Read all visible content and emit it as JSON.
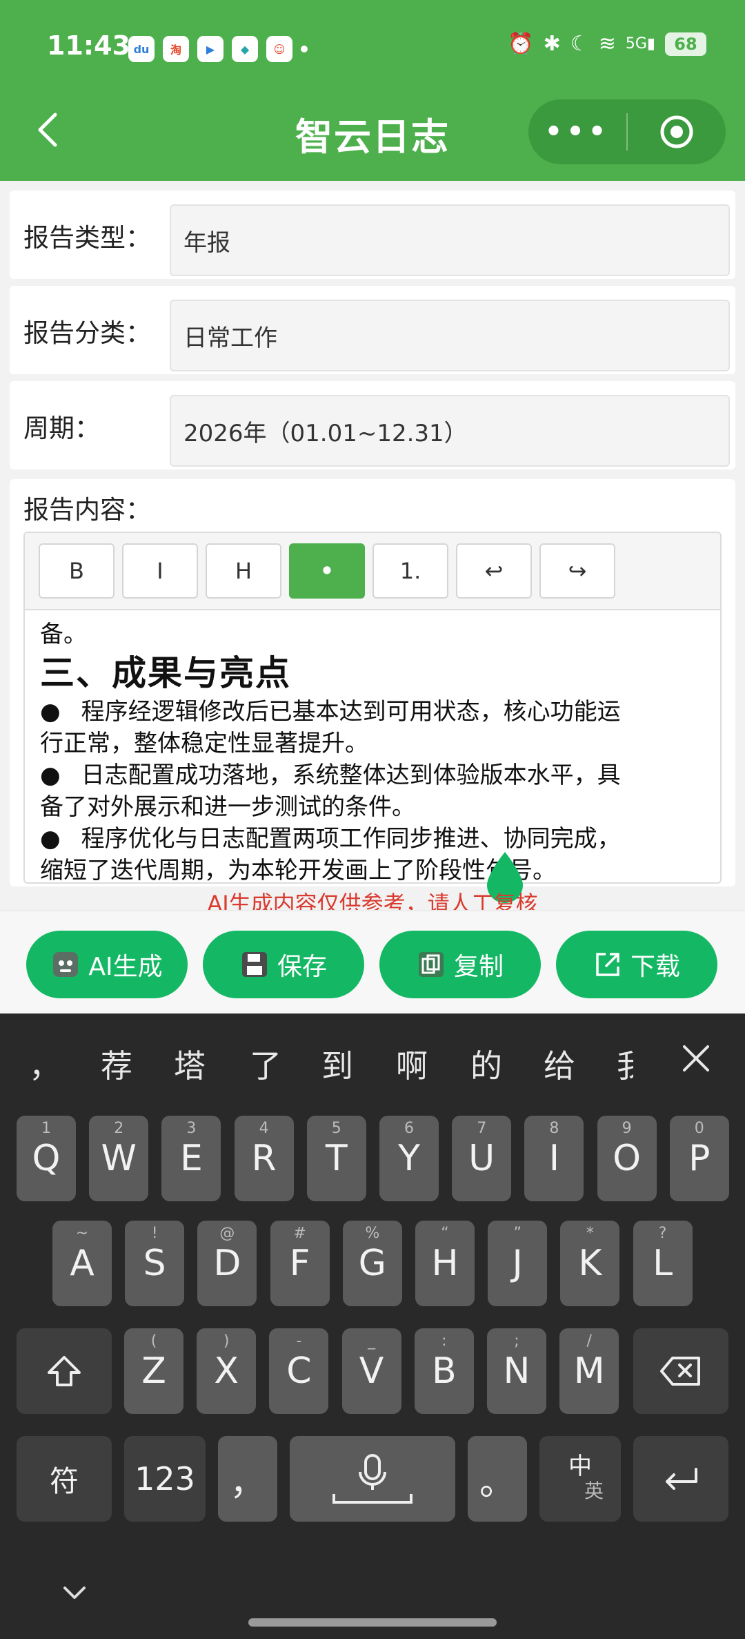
{
  "status_bar": {
    "time": "11:43",
    "battery": "68",
    "network": "5G"
  },
  "header": {
    "title": "智云日志",
    "more_label": "•••"
  },
  "form": {
    "report_type_label": "报告类型：",
    "report_type_value": "年报",
    "report_category_label": "报告分类：",
    "report_category_value": "日常工作",
    "period_label": "周期：",
    "period_value": "2026年（01.01~12.31）",
    "content_label": "报告内容："
  },
  "editor": {
    "toolbar": [
      "B",
      "I",
      "H",
      "•",
      "1.",
      "↩",
      "↪"
    ],
    "lines": {
      "prev_tail": "备。",
      "heading": "三、成果与亮点",
      "b1a": "程序经逻辑修改后已基本达到可用状态，核心功能运",
      "b1b": "行正常，整体稳定性显著提升。",
      "b2a": "日志配置成功落地，系统整体达到体验版本水平，具",
      "b2b": "备了对外展示和进一步测试的条件。",
      "b3a": "程序优化与日志配置两项工作同步推进、协同完成，",
      "b3b": "缩短了迭代周期，为本轮开发画上了阶段性句号。"
    },
    "bullet": "●"
  },
  "notice": "AI生成内容仅供参考，请人工复核",
  "actions": {
    "ai_generate": "AI生成",
    "save": "保存",
    "copy": "复制",
    "download": "下载"
  },
  "keyboard": {
    "candidates": [
      "，",
      "荐",
      "塔",
      "了",
      "到",
      "啊",
      "的",
      "给",
      "我"
    ],
    "row1": [
      [
        "Q",
        "1"
      ],
      [
        "W",
        "2"
      ],
      [
        "E",
        "3"
      ],
      [
        "R",
        "4"
      ],
      [
        "T",
        "5"
      ],
      [
        "Y",
        "6"
      ],
      [
        "U",
        "7"
      ],
      [
        "I",
        "8"
      ],
      [
        "O",
        "9"
      ],
      [
        "P",
        "0"
      ]
    ],
    "row2": [
      [
        "A",
        "~"
      ],
      [
        "S",
        "!"
      ],
      [
        "D",
        "@"
      ],
      [
        "F",
        "#"
      ],
      [
        "G",
        "%"
      ],
      [
        "H",
        "“"
      ],
      [
        "J",
        "”"
      ],
      [
        "K",
        "*"
      ],
      [
        "L",
        "?"
      ]
    ],
    "row3": [
      [
        "Z",
        "("
      ],
      [
        "X",
        ")"
      ],
      [
        "C",
        "-"
      ],
      [
        "V",
        "_"
      ],
      [
        "B",
        ":"
      ],
      [
        "N",
        ";"
      ],
      [
        "M",
        "/"
      ]
    ],
    "symbol_key": "符",
    "num_key": "123",
    "comma_key": "，",
    "period_key": "。",
    "lang_key_top": "中",
    "lang_key_bottom": "英"
  },
  "colors": {
    "header_green": "#4db04d",
    "button_green": "#14b864",
    "notice_red": "#d93b2f",
    "keyboard_bg": "#292929"
  }
}
